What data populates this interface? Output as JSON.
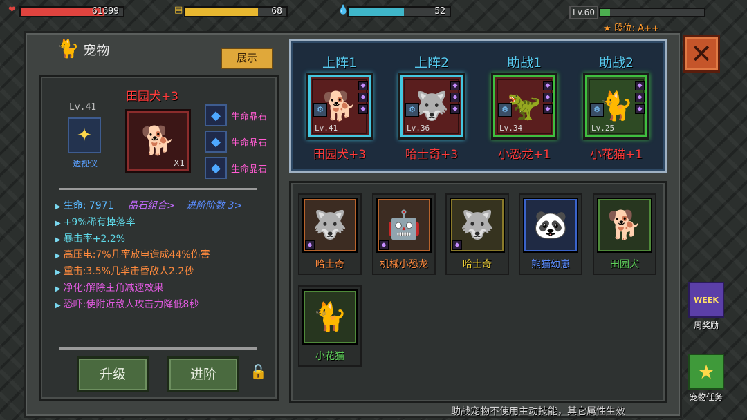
{
  "hud": {
    "hp": {
      "value": "61699",
      "fill": 0.82,
      "color": "#e0443f"
    },
    "energy": {
      "value": "68",
      "fill": 0.72,
      "color": "#e8b830"
    },
    "water": {
      "value": "52",
      "fill": 0.55,
      "color": "#3fb6c9"
    },
    "level": {
      "label": "Lv.60",
      "fill": 0.09
    },
    "rank": "★ 段位: A++"
  },
  "header": {
    "title": "宠物",
    "show_button": "展示"
  },
  "current_pet": {
    "level": "Lv.41",
    "equip_label": "透视仪",
    "name": "田园犬+3",
    "count": "X1",
    "gems": [
      "生命晶石",
      "生命晶石",
      "生命晶石"
    ]
  },
  "stats": [
    {
      "text": "生命: 7971",
      "color": "#5ab8ff"
    },
    {
      "text": "晶石组合>",
      "color": "#c66cff"
    },
    {
      "text": "进阶阶数 3>",
      "color": "#5a8cff"
    },
    {
      "text": "+9%稀有掉落率",
      "color": "#5fd9e8"
    },
    {
      "text": "暴击率+2.2%",
      "color": "#5fd9e8"
    },
    {
      "text": "高压电:7%几率放电造成44%伤害",
      "color": "#ff8a3d"
    },
    {
      "text": "重击:3.5%几率击昏敌人2.2秒",
      "color": "#ff8a3d"
    },
    {
      "text": "净化:解除主角减速效果",
      "color": "#e05adf"
    },
    {
      "text": "恐吓:使附近敌人攻击力降低8秒",
      "color": "#e05adf"
    }
  ],
  "actions": {
    "upgrade": "升级",
    "advance": "进阶"
  },
  "team": [
    {
      "title": "上阵1",
      "level": "Lv.41",
      "name": "田园犬+3",
      "frame": "#44c7e0",
      "bg": "#5a1e1e"
    },
    {
      "title": "上阵2",
      "level": "Lv.36",
      "name": "哈士奇+3",
      "frame": "#44c7e0",
      "bg": "#5a1e1e"
    },
    {
      "title": "助战1",
      "level": "Lv.34",
      "name": "小恐龙+1",
      "frame": "#3fbf3f",
      "bg": "#5a1e1e"
    },
    {
      "title": "助战2",
      "level": "Lv.25",
      "name": "小花猫+1",
      "frame": "#3fbf3f",
      "bg": "#2e4a24"
    }
  ],
  "pets": [
    {
      "name": "哈士奇",
      "color": "#ff8a3d",
      "bg": "#3c2c22",
      "frame": "#b8632b"
    },
    {
      "name": "机械小恐龙",
      "color": "#ff8a3d",
      "bg": "#3c2c22",
      "frame": "#b8632b"
    },
    {
      "name": "哈士奇",
      "color": "#f0d23a",
      "bg": "#36331f",
      "frame": "#8a7a2a"
    },
    {
      "name": "熊猫幼崽",
      "color": "#5a8cff",
      "bg": "#1f2a44",
      "frame": "#3a63c9"
    },
    {
      "name": "田园犬",
      "color": "#5fd05a",
      "bg": "#27361f",
      "frame": "#4f8a3a"
    },
    {
      "name": "小花猫",
      "color": "#5fd05a",
      "bg": "#27361f",
      "frame": "#4f8a3a"
    }
  ],
  "footnote": "助战宠物不使用主动技能，其它属性生效",
  "side": {
    "weekly": "周奖励",
    "pet_task": "宠物任务",
    "weekly_badge": "WEEK"
  }
}
